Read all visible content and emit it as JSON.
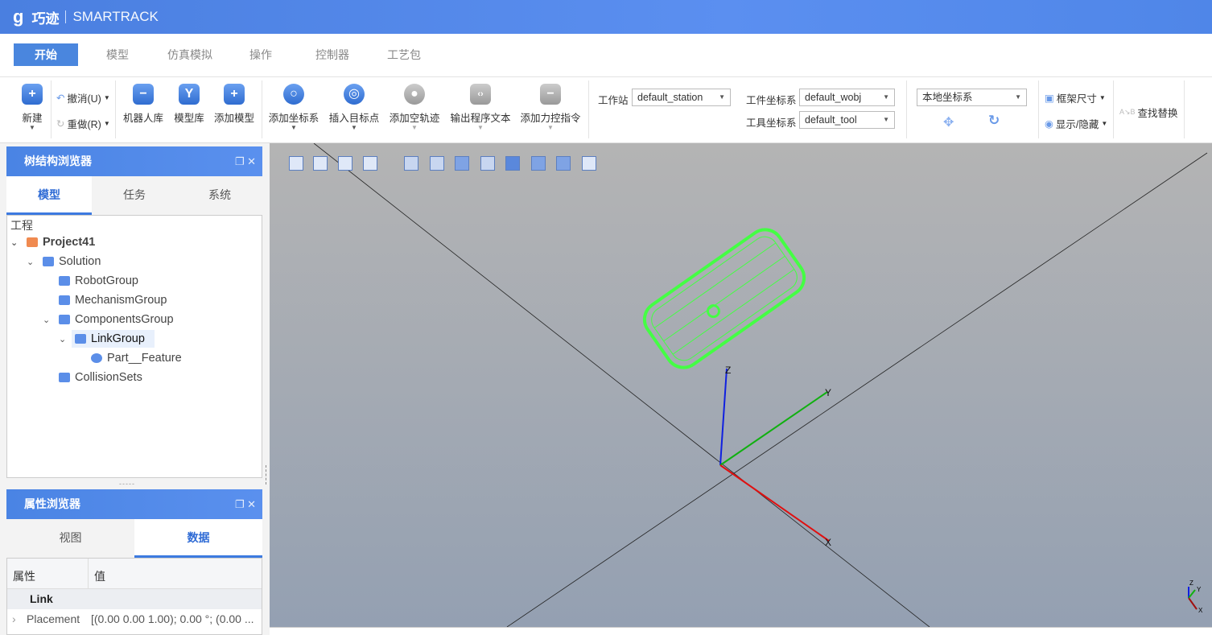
{
  "app": {
    "logo_text": "巧迹",
    "name": "SMARTRACK"
  },
  "menu": [
    "开始",
    "模型",
    "仿真模拟",
    "操作",
    "控制器",
    "工艺包"
  ],
  "ribbon": {
    "new": "新建",
    "undo": "撤消(U)",
    "redo": "重做(R)",
    "robot_lib": "机器人库",
    "model_lib": "模型库",
    "add_model": "添加模型",
    "add_frame": "添加坐标系",
    "insert_target": "插入目标点",
    "add_empty_path": "添加空轨迹",
    "export_program": "输出程序文本",
    "add_force_cmd": "添加力控指令",
    "station_label": "工作站",
    "station_value": "default_station",
    "wobj_label": "工件坐标系",
    "wobj_value": "default_wobj",
    "tool_label": "工具坐标系",
    "tool_value": "default_tool",
    "coord_value": "本地坐标系",
    "frame_size": "框架尺寸",
    "show_hide": "显示/隐藏",
    "find_replace": "查找替换"
  },
  "tree_panel": {
    "title": "树结构浏览器",
    "tabs": [
      "模型",
      "任务",
      "系统"
    ],
    "root": "工程",
    "nodes": [
      "Project41",
      "Solution",
      "RobotGroup",
      "MechanismGroup",
      "ComponentsGroup",
      "LinkGroup",
      "Part__Feature",
      "CollisionSets"
    ]
  },
  "prop_panel": {
    "title": "属性浏览器",
    "tabs": [
      "视图",
      "数据"
    ],
    "col_prop": "属性",
    "col_value": "值",
    "group": "Link",
    "rows": [
      {
        "name": "Placement",
        "value": "[(0.00 0.00 1.00); 0.00 °; (0.00 ..."
      }
    ]
  },
  "viewport": {
    "axis_labels": [
      "X",
      "Y",
      "Z"
    ],
    "colors": {
      "x": "#e01010",
      "y": "#10b010",
      "z": "#1020e0",
      "selection": "#44ff44"
    }
  }
}
